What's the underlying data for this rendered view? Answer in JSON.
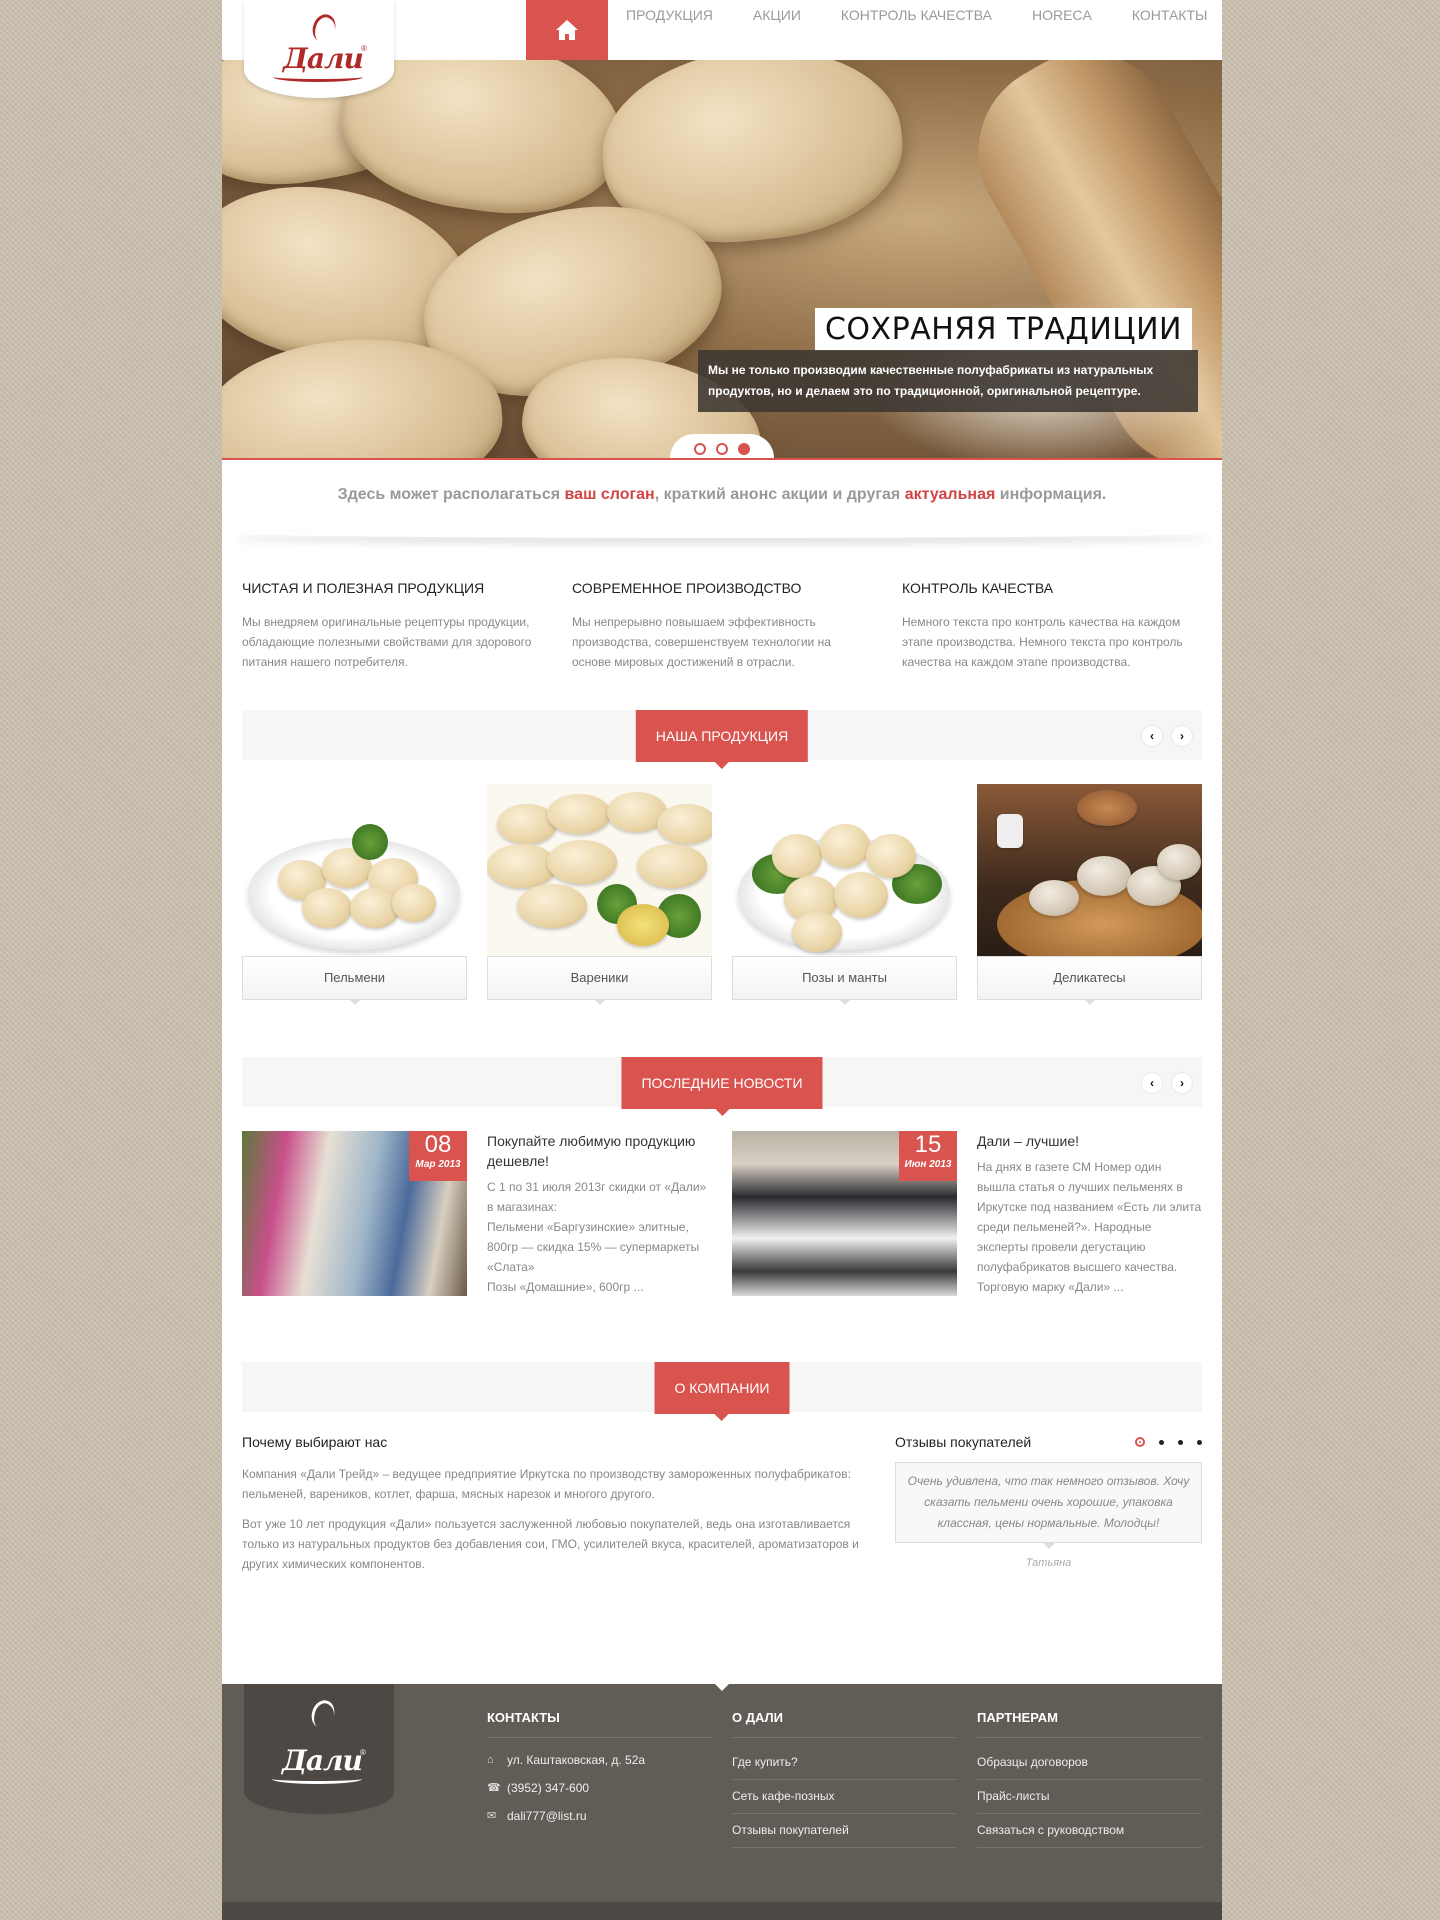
{
  "nav": {
    "items": [
      {
        "label": "ПРОДУКЦИЯ"
      },
      {
        "label": "АКЦИИ"
      },
      {
        "label": "КОНТРОЛЬ КАЧЕСТВА"
      },
      {
        "label": "HORECA"
      },
      {
        "label": "КОНТАКТЫ"
      }
    ]
  },
  "logo": {
    "text": "Дали",
    "reg": "®"
  },
  "slider": {
    "title": "СОХРАНЯЯ ТРАДИЦИИ",
    "caption": "Мы не только производим качественные полуфабрикаты из натуральных продуктов, но и делаем это по традиционной, оригинальной рецептуре.",
    "dots": 3,
    "active_dot": 3
  },
  "slogan": {
    "p1": "Здесь может располагаться ",
    "h1": "ваш слоган",
    "p2": ", краткий анонс акции и другая ",
    "h2": "актуальная",
    "p3": " информация."
  },
  "features": [
    {
      "title": "ЧИСТАЯ И ПОЛЕЗНАЯ ПРОДУКЦИЯ",
      "text": "Мы внедряем оригинальные рецептуры продукции, обладающие полезными свойствами для здорового питания нашего потребителя."
    },
    {
      "title": "СОВРЕМЕННОЕ ПРОИЗВОДСТВО",
      "text": "Мы непрерывно повышаем эффективность производства, совершенствуем технологии на основе мировых достижений в отрасли."
    },
    {
      "title": "КОНТРОЛЬ КАЧЕСТВА",
      "text": "Немного текста про контроль качества на каждом этапе производства. Немного текста про контроль качества на каждом этапе производства."
    }
  ],
  "products_section": {
    "title": "НАША ПРОДУКЦИЯ",
    "items": [
      {
        "label": "Пельмени"
      },
      {
        "label": "Вареники"
      },
      {
        "label": "Позы и манты"
      },
      {
        "label": "Деликатесы"
      }
    ]
  },
  "news_section": {
    "title": "ПОСЛЕДНИЕ НОВОСТИ",
    "items": [
      {
        "day": "08",
        "month": "Мар 2013",
        "title": "Покупайте любимую продукцию дешевле!",
        "lines": [
          "С 1 по 31 июля 2013г скидки от «Дали» в магазинах:",
          "Пельмени «Баргузинские» элитные, 800гр — скидка 15% — супермаркеты «Слата»",
          "Позы «Домашние», 600гр ..."
        ]
      },
      {
        "day": "15",
        "month": "Июн 2013",
        "title": "Дали – лучшие!",
        "lines": [
          "На днях в газете СМ Номер один вышла статья о лучших пельменях в Иркутске под названием «Есть ли элита среди пельменей?». Народные эксперты провели дегустацию полуфабрикатов высшего качества. Торговую марку «Дали» ..."
        ]
      }
    ]
  },
  "about_section": {
    "title": "О КОМПАНИИ",
    "heading": "Почему выбирают нас",
    "p1": "Компания «Дали Трейд» – ведущее предприятие Иркутска по производству замороженных полуфабрикатов: пельменей, вареников, котлет, фарша, мясных нарезок и многого другого.",
    "p2": "Вот уже 10 лет продукция «Дали» пользуется заслуженной любовью покупателей, ведь она изготавливается только из натуральных продуктов без добавления сои, ГМО, усилителей вкуса, красителей, ароматизаторов и других химических компонентов."
  },
  "reviews": {
    "title": "Отзывы покупателей",
    "text": "Очень удивлена, что так немного отзывов. Хочу сказать пельмени очень хорошие, упаковка классная, цены нормальные. Молодцы!",
    "author": "Татьяна",
    "dots": 4,
    "active_dot": 1
  },
  "footer": {
    "contacts": {
      "title": "КОНТАКТЫ",
      "address": "ул. Каштаковская, д. 52а",
      "phone": "(3952) 347-600",
      "email": "dali777@list.ru"
    },
    "about": {
      "title": "О ДАЛИ",
      "links": [
        "Где купить?",
        "Сеть кафе-позных",
        "Отзывы покупателей"
      ]
    },
    "partners": {
      "title": "ПАРТНЕРАМ",
      "links": [
        "Образцы договоров",
        "Прайс-листы",
        "Связаться с руководством"
      ]
    }
  },
  "colors": {
    "accent": "#d9534f",
    "footer": "#625c57",
    "background": "#c9bfae"
  },
  "icons": {
    "home": "home-icon",
    "prev": "chevron-left-icon",
    "next": "chevron-right-icon",
    "address": "home-icon",
    "phone": "phone-icon",
    "email": "envelope-icon"
  }
}
